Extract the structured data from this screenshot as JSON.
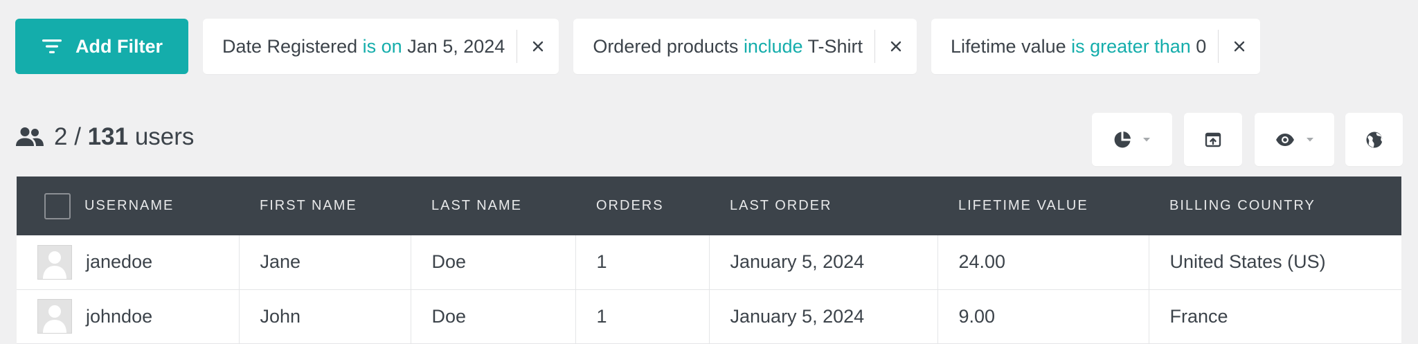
{
  "filters": {
    "add_filter_label": "Add Filter",
    "chips": [
      {
        "field": "Date Registered",
        "operator": "is on",
        "value": "Jan 5, 2024"
      },
      {
        "field": "Ordered products",
        "operator": "include",
        "value": "T-Shirt"
      },
      {
        "field": "Lifetime value",
        "operator": "is greater than",
        "value": "0"
      }
    ]
  },
  "summary": {
    "filtered_count": "2",
    "separator": "/",
    "total_count": "131",
    "unit": "users"
  },
  "toolbar": {
    "buttons": [
      "pie-chart-icon",
      "export-icon",
      "eye-icon",
      "globe-icon"
    ]
  },
  "table": {
    "columns": [
      "USERNAME",
      "FIRST NAME",
      "LAST NAME",
      "ORDERS",
      "LAST ORDER",
      "LIFETIME VALUE",
      "BILLING COUNTRY"
    ],
    "rows": [
      {
        "username": "janedoe",
        "first_name": "Jane",
        "last_name": "Doe",
        "orders": "1",
        "last_order": "January 5, 2024",
        "lifetime_value": "24.00",
        "billing_country": "United States (US)"
      },
      {
        "username": "johndoe",
        "first_name": "John",
        "last_name": "Doe",
        "orders": "1",
        "last_order": "January 5, 2024",
        "lifetime_value": "9.00",
        "billing_country": "France"
      }
    ]
  },
  "colors": {
    "accent": "#14adab",
    "header_bg": "#3c434a",
    "page_bg": "#f0f0f1",
    "text": "#3c434a"
  }
}
